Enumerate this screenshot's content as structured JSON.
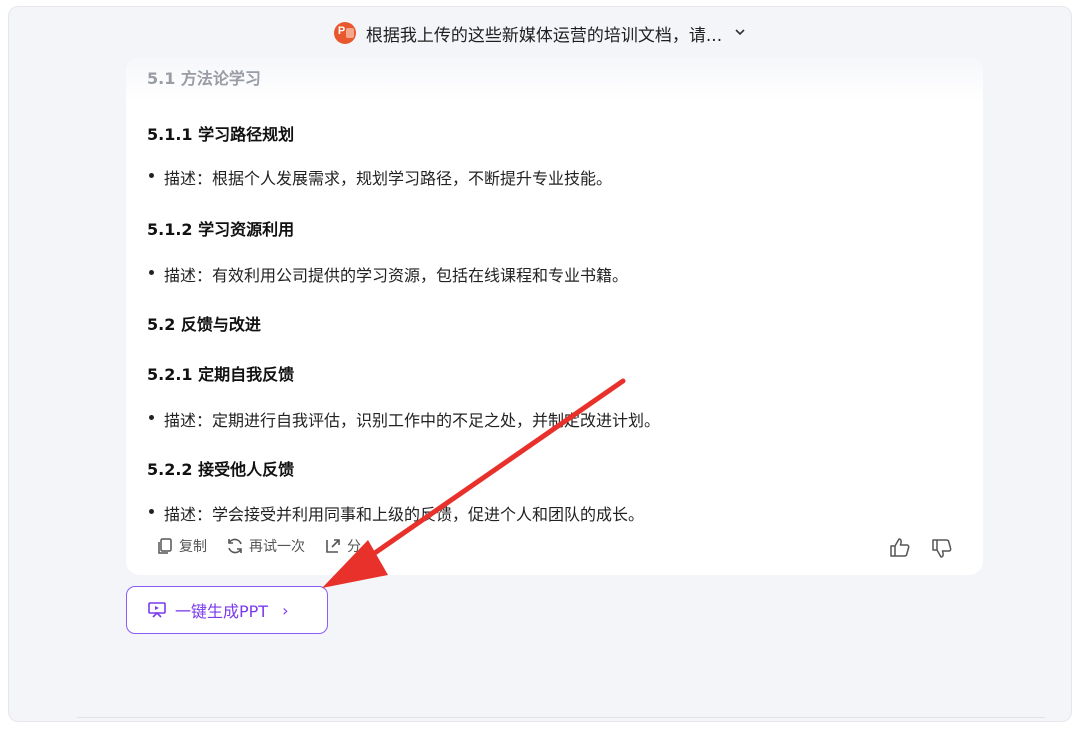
{
  "topbar": {
    "title": "根据我上传的这些新媒体运营的培训文档，请...",
    "file_icon": "powerpoint-icon",
    "chevron_icon": "chevron-down-icon"
  },
  "content": {
    "faded_heading": "5.1 方法论学习",
    "sections": [
      {
        "heading": "5.1.1 学习路径规划",
        "bullet": "描述：根据个人发展需求，规划学习路径，不断提升专业技能。"
      },
      {
        "heading": "5.1.2 学习资源利用",
        "bullet": "描述：有效利用公司提供的学习资源，包括在线课程和专业书籍。"
      },
      {
        "heading": "5.2 反馈与改进",
        "bullet": null
      },
      {
        "heading": "5.2.1 定期自我反馈",
        "bullet": "描述：定期进行自我评估，识别工作中的不足之处，并制定改进计划。"
      },
      {
        "heading": "5.2.2 接受他人反馈",
        "bullet": "描述：学会接受并利用同事和上级的反馈，促进个人和团队的成长。"
      }
    ]
  },
  "actions": {
    "copy": "复制",
    "retry": "再试一次",
    "share": "分",
    "thumbs_up_icon": "thumbs-up-icon",
    "thumbs_down_icon": "thumbs-down-icon"
  },
  "generate": {
    "label": "一键生成PPT",
    "icon": "presentation-icon",
    "chevron": "›"
  },
  "colors": {
    "accent": "#8b5cf6",
    "annotation_arrow": "#e8312b"
  }
}
